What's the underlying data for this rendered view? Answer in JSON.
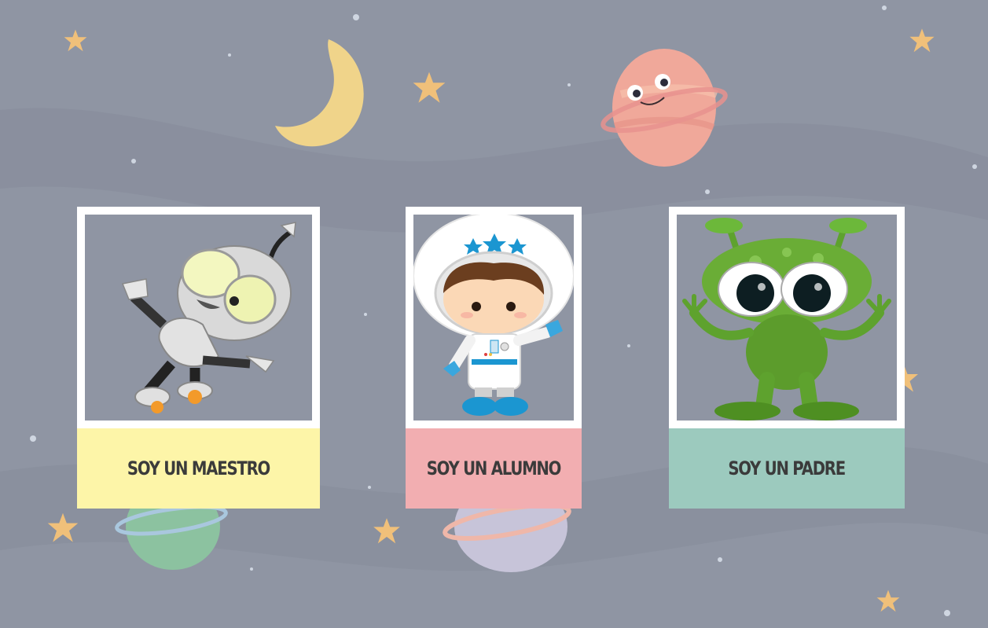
{
  "theme": {
    "background": "#8f95a3",
    "frame": "#ffffff",
    "label_text": "#3b3b3b"
  },
  "cards": [
    {
      "id": "maestro",
      "label": "SOY UN MAESTRO",
      "color": "#fdf5a8",
      "icon": "robot-icon"
    },
    {
      "id": "alumno",
      "label": "SOY UN ALUMNO",
      "color": "#f2aeb1",
      "icon": "astronaut-icon"
    },
    {
      "id": "padre",
      "label": "SOY UN PADRE",
      "color": "#9ccabe",
      "icon": "alien-icon"
    }
  ]
}
